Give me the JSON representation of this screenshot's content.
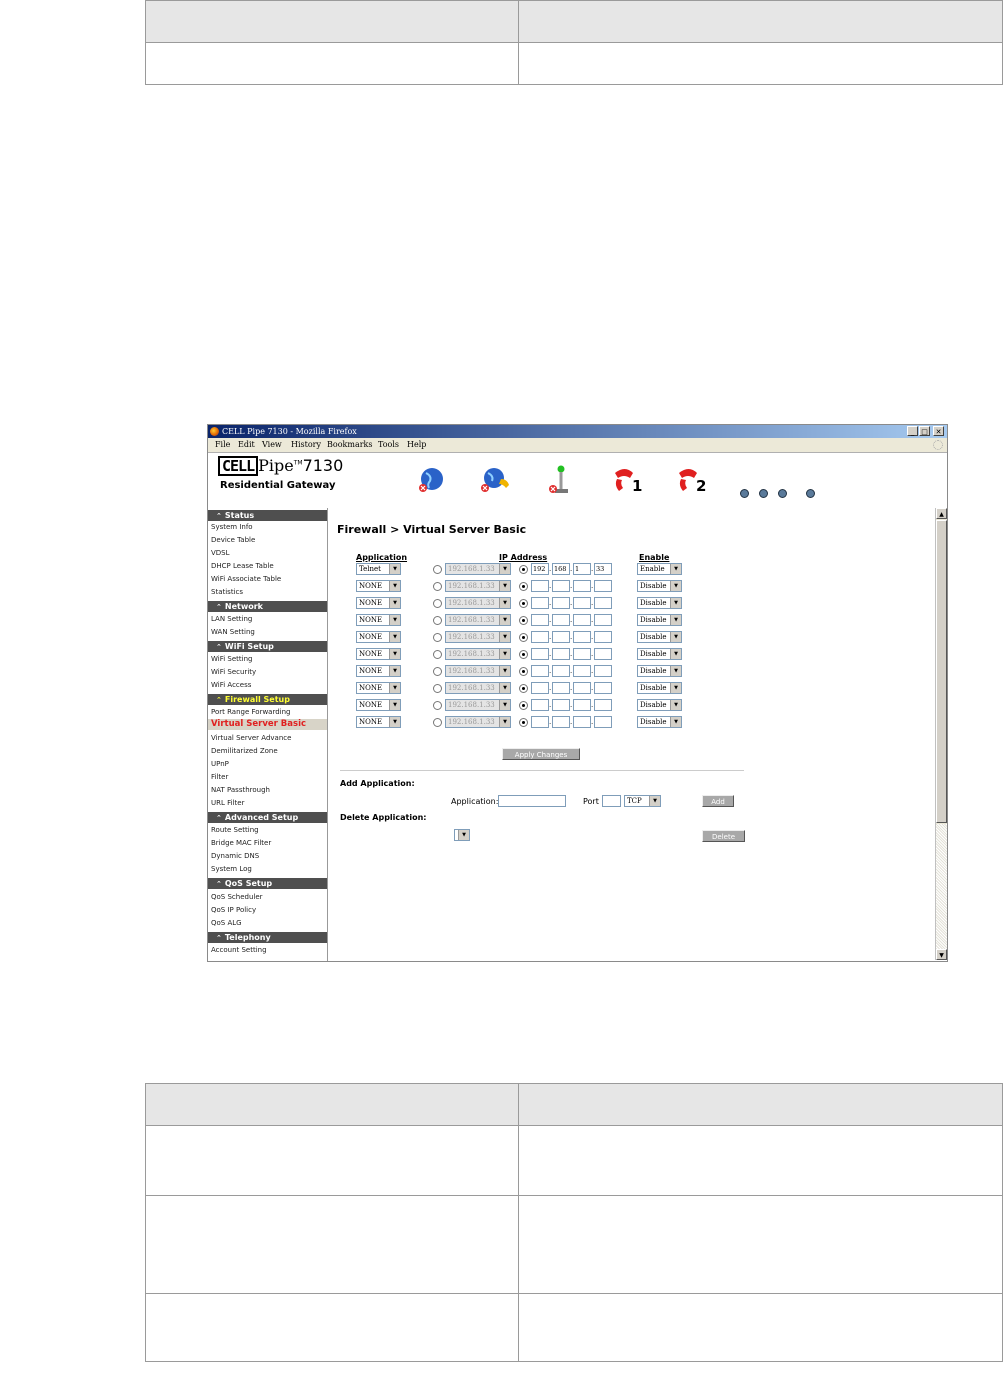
{
  "window": {
    "title": "CELL Pipe 7130 - Mozilla Firefox",
    "buttons": [
      "_",
      "□",
      "✕"
    ]
  },
  "menubar": [
    "File",
    "Edit",
    "View",
    "History",
    "Bookmarks",
    "Tools",
    "Help"
  ],
  "logo": {
    "brand_box": "CELL",
    "brand_rest": "Pipe",
    "tm": "TM",
    "model": "7130",
    "subtitle": "Residential Gateway"
  },
  "banner_icons": [
    {
      "name": "internet-globe-error-icon"
    },
    {
      "name": "voip-globe-error-icon"
    },
    {
      "name": "antenna-error-icon"
    },
    {
      "name": "phone-line-1-icon",
      "label": "1"
    },
    {
      "name": "phone-line-2-icon",
      "label": "2"
    }
  ],
  "sidebar": {
    "sections": [
      {
        "title": "Status",
        "items": [
          "System Info",
          "Device Table",
          "VDSL",
          "DHCP Lease Table",
          "WiFi Associate Table",
          "Statistics"
        ]
      },
      {
        "title": "Network",
        "items": [
          "LAN Setting",
          "WAN Setting"
        ]
      },
      {
        "title": "WiFi Setup",
        "items": [
          "WiFi Setting",
          "WiFi Security",
          "WiFi Access"
        ]
      },
      {
        "title": "Firewall Setup",
        "active": true,
        "items": [
          "Port Range Forwarding",
          "Virtual Server Basic",
          "Virtual Server Advance",
          "Demilitarized Zone",
          "UPnP",
          "Filter",
          "NAT Passthrough",
          "URL Filter"
        ]
      },
      {
        "title": "Advanced Setup",
        "items": [
          "Route Setting",
          "Bridge MAC Filter",
          "Dynamic DNS",
          "System Log"
        ]
      },
      {
        "title": "QoS Setup",
        "items": [
          "QoS Scheduler",
          "QoS IP Policy",
          "QoS ALG"
        ]
      },
      {
        "title": "Telephony",
        "items": [
          "Account Setting"
        ]
      }
    ],
    "current_item": "Virtual Server Basic"
  },
  "content": {
    "title": "Firewall > Virtual Server Basic",
    "headers": {
      "application": "Application",
      "ip_address": "IP Address",
      "enable": "Enable"
    },
    "rows": [
      {
        "app": "Telnet",
        "ip_select": "192.168.1.33",
        "ip": [
          "192",
          "168",
          "1",
          "33"
        ],
        "enable": "Enable"
      },
      {
        "app": "NONE",
        "ip_select": "192.168.1.33",
        "ip": [
          "",
          "",
          "",
          ""
        ],
        "enable": "Disable"
      },
      {
        "app": "NONE",
        "ip_select": "192.168.1.33",
        "ip": [
          "",
          "",
          "",
          ""
        ],
        "enable": "Disable"
      },
      {
        "app": "NONE",
        "ip_select": "192.168.1.33",
        "ip": [
          "",
          "",
          "",
          ""
        ],
        "enable": "Disable"
      },
      {
        "app": "NONE",
        "ip_select": "192.168.1.33",
        "ip": [
          "",
          "",
          "",
          ""
        ],
        "enable": "Disable"
      },
      {
        "app": "NONE",
        "ip_select": "192.168.1.33",
        "ip": [
          "",
          "",
          "",
          ""
        ],
        "enable": "Disable"
      },
      {
        "app": "NONE",
        "ip_select": "192.168.1.33",
        "ip": [
          "",
          "",
          "",
          ""
        ],
        "enable": "Disable"
      },
      {
        "app": "NONE",
        "ip_select": "192.168.1.33",
        "ip": [
          "",
          "",
          "",
          ""
        ],
        "enable": "Disable"
      },
      {
        "app": "NONE",
        "ip_select": "192.168.1.33",
        "ip": [
          "",
          "",
          "",
          ""
        ],
        "enable": "Disable"
      },
      {
        "app": "NONE",
        "ip_select": "192.168.1.33",
        "ip": [
          "",
          "",
          "",
          ""
        ],
        "enable": "Disable"
      }
    ],
    "apply_button": "Apply Changes",
    "add_application": {
      "heading": "Add Application:",
      "app_label": "Application:",
      "app_value": "",
      "port_label": "Port",
      "port_value": "",
      "protocol": "TCP",
      "add_button": "Add"
    },
    "delete_application": {
      "heading": "Delete Application:",
      "selected": "",
      "delete_button": "Delete"
    }
  }
}
